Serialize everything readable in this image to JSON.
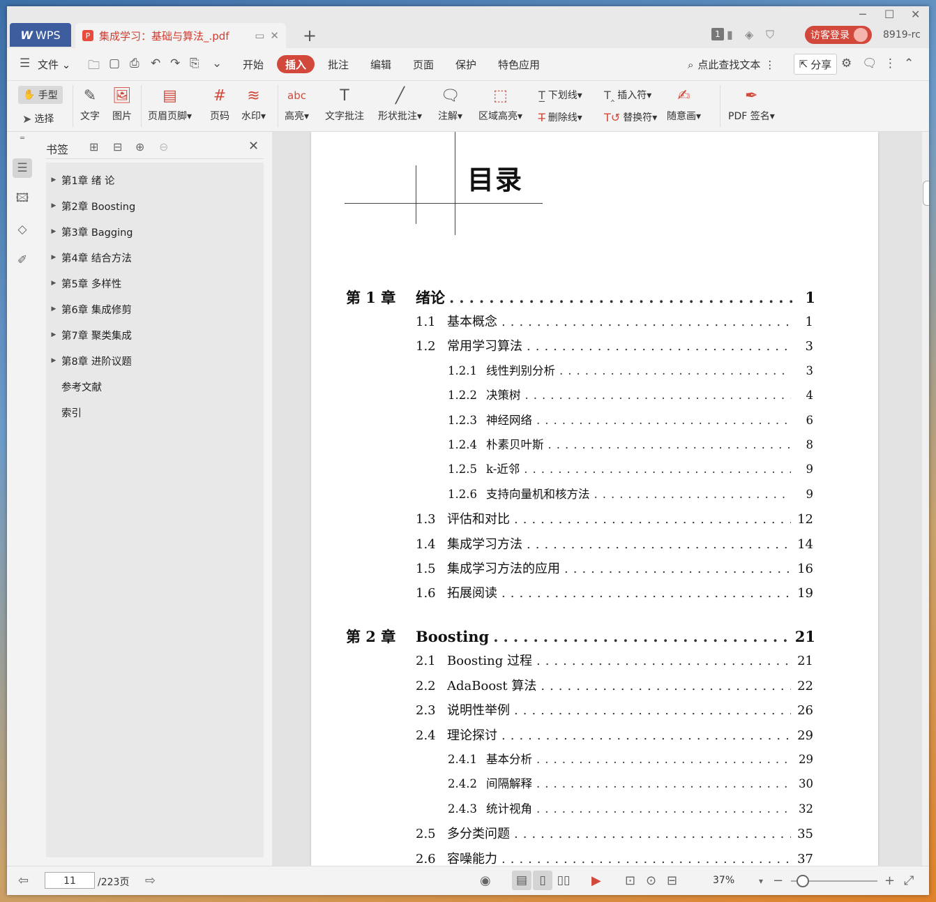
{
  "titlebar": {
    "app_name": "WPS",
    "doc_tab_title": "集成学习：基础与算法_.pdf",
    "page_badge": "1",
    "login_label": "访客登录",
    "user_id": "8919-rc"
  },
  "menubar": {
    "file_label": "文件",
    "items": [
      "开始",
      "插入",
      "批注",
      "编辑",
      "页面",
      "保护",
      "特色应用"
    ],
    "active": "插入",
    "search_label": "点此查找文本",
    "share_label": "分享"
  },
  "ribbon": {
    "hand_label": "手型",
    "select_label": "选择",
    "text_label": "文字",
    "image_label": "图片",
    "header_footer_label": "页眉页脚",
    "page_num_label": "页码",
    "watermark_label": "水印",
    "highlight_label": "高亮",
    "text_comment_label": "文字批注",
    "shape_comment_label": "形状批注",
    "note_label": "注解",
    "area_highlight_label": "区域高亮",
    "underline_label": "下划线",
    "strikethrough_label": "删除线",
    "insert_mark_label": "插入符",
    "replace_mark_label": "替换符",
    "freehand_label": "随意画",
    "pdf_sign_label": "PDF 签名"
  },
  "bookmarks": {
    "title": "书签",
    "items": [
      {
        "label": "第1章 绪 论",
        "expandable": true
      },
      {
        "label": "第2章 Boosting",
        "expandable": true
      },
      {
        "label": "第3章 Bagging",
        "expandable": true
      },
      {
        "label": "第4章 结合方法",
        "expandable": true
      },
      {
        "label": "第5章 多样性",
        "expandable": true
      },
      {
        "label": "第6章 集成修剪",
        "expandable": true
      },
      {
        "label": "第7章 聚类集成",
        "expandable": true
      },
      {
        "label": "第8章 进阶议题",
        "expandable": true
      },
      {
        "label": "参考文献",
        "expandable": false
      },
      {
        "label": "索引",
        "expandable": false
      }
    ]
  },
  "page": {
    "toc_title": "目录",
    "entries": [
      {
        "level": 0,
        "num": "第 1 章",
        "title": "绪论",
        "page": "1"
      },
      {
        "level": 1,
        "num": "1.1",
        "title": "基本概念",
        "page": "1"
      },
      {
        "level": 1,
        "num": "1.2",
        "title": "常用学习算法",
        "page": "3"
      },
      {
        "level": 2,
        "num": "1.2.1",
        "title": "线性判别分析",
        "page": "3"
      },
      {
        "level": 2,
        "num": "1.2.2",
        "title": "决策树",
        "page": "4"
      },
      {
        "level": 2,
        "num": "1.2.3",
        "title": "神经网络",
        "page": "6"
      },
      {
        "level": 2,
        "num": "1.2.4",
        "title": "朴素贝叶斯",
        "page": "8"
      },
      {
        "level": 2,
        "num": "1.2.5",
        "title": "k-近邻",
        "page": "9"
      },
      {
        "level": 2,
        "num": "1.2.6",
        "title": "支持向量机和核方法",
        "page": "9"
      },
      {
        "level": 1,
        "num": "1.3",
        "title": "评估和对比",
        "page": "12"
      },
      {
        "level": 1,
        "num": "1.4",
        "title": "集成学习方法",
        "page": "14"
      },
      {
        "level": 1,
        "num": "1.5",
        "title": "集成学习方法的应用",
        "page": "16"
      },
      {
        "level": 1,
        "num": "1.6",
        "title": "拓展阅读",
        "page": "19"
      },
      {
        "level": 0,
        "num": "第 2 章",
        "title": "Boosting",
        "page": "21"
      },
      {
        "level": 1,
        "num": "2.1",
        "title": "Boosting 过程",
        "page": "21"
      },
      {
        "level": 1,
        "num": "2.2",
        "title": "AdaBoost 算法",
        "page": "22"
      },
      {
        "level": 1,
        "num": "2.3",
        "title": "说明性举例",
        "page": "26"
      },
      {
        "level": 1,
        "num": "2.4",
        "title": "理论探讨",
        "page": "29"
      },
      {
        "level": 2,
        "num": "2.4.1",
        "title": "基本分析",
        "page": "29"
      },
      {
        "level": 2,
        "num": "2.4.2",
        "title": "间隔解释",
        "page": "30"
      },
      {
        "level": 2,
        "num": "2.4.3",
        "title": "统计视角",
        "page": "32"
      },
      {
        "level": 1,
        "num": "2.5",
        "title": "多分类问题",
        "page": "35"
      },
      {
        "level": 1,
        "num": "2.6",
        "title": "容噪能力",
        "page": "37"
      }
    ]
  },
  "statusbar": {
    "current_page": "11",
    "total_pages": "/223页",
    "zoom": "37%",
    "zoom_fraction": 0.12
  }
}
